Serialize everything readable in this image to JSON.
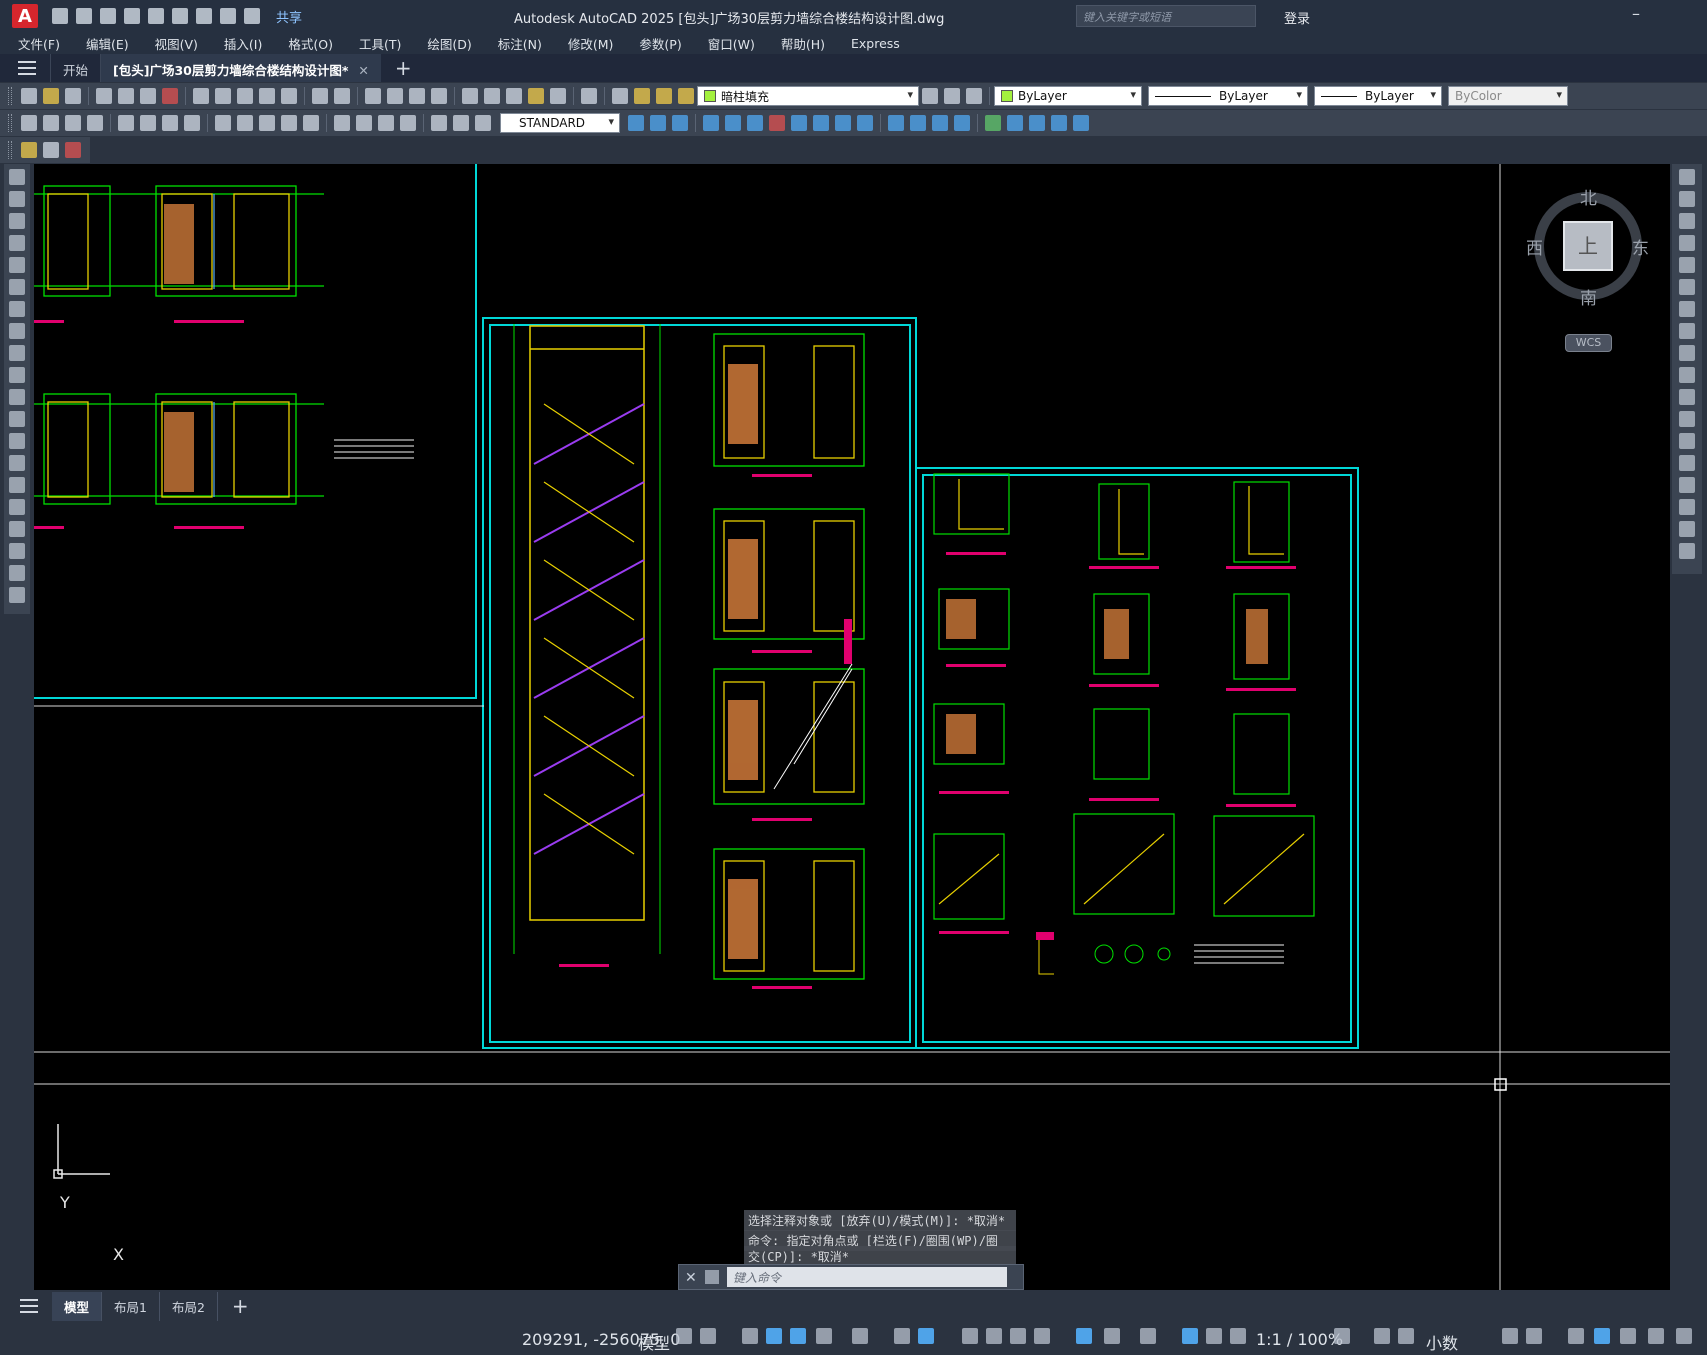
{
  "app": {
    "window_title": "Autodesk AutoCAD 2025    [包头]广场30层剪力墙综合楼结构设计图.dwg",
    "share_label": "共享",
    "search_placeholder": "键入关键字或短语",
    "login_label": "登录"
  },
  "menu": [
    "文件(F)",
    "编辑(E)",
    "视图(V)",
    "插入(I)",
    "格式(O)",
    "工具(T)",
    "绘图(D)",
    "标注(N)",
    "修改(M)",
    "参数(P)",
    "窗口(W)",
    "帮助(H)",
    "Express"
  ],
  "tabs": [
    {
      "label": "开始"
    },
    {
      "label": "[包头]广场30层剪力墙综合楼结构设计图*",
      "active": true
    }
  ],
  "toolbar": {
    "layer_name": "暗柱填充",
    "color": "ByLayer",
    "linetype": "ByLayer",
    "lineweight": "ByLayer",
    "plotstyle": "ByColor",
    "text_style": "STANDARD",
    "layer_swatch_color": "#a3f03e"
  },
  "viewcube": {
    "north": "北",
    "south": "南",
    "east": "东",
    "west": "西",
    "face": "上",
    "wcs": "WCS"
  },
  "ucs": {
    "y": "Y",
    "x": "X"
  },
  "command": {
    "history_1": "选择注释对象或 [放弃(U)/模式(M)]: *取消*",
    "history_2": "命令: 指定对角点或 [栏选(F)/圈围(WP)/圈",
    "history_3": "交(CP)]: *取消*",
    "input_placeholder": "键入命令"
  },
  "layout_tabs": [
    {
      "label": "模型",
      "active": true
    },
    {
      "label": "布局1"
    },
    {
      "label": "布局2"
    }
  ],
  "status": {
    "coordinates": "209291, -256075, 0",
    "mode": "模型",
    "annotation_scale": "1:1 / 100%",
    "units": "小数"
  },
  "colors": {
    "canvas": "#000000",
    "border_cyan": "#00d8d8",
    "line_green": "#00e000",
    "line_yellow": "#e8d000",
    "accent_magenta": "#e0006e",
    "hatch_orange": "#d07a3a",
    "stair_purple": "#9a3cf0"
  }
}
